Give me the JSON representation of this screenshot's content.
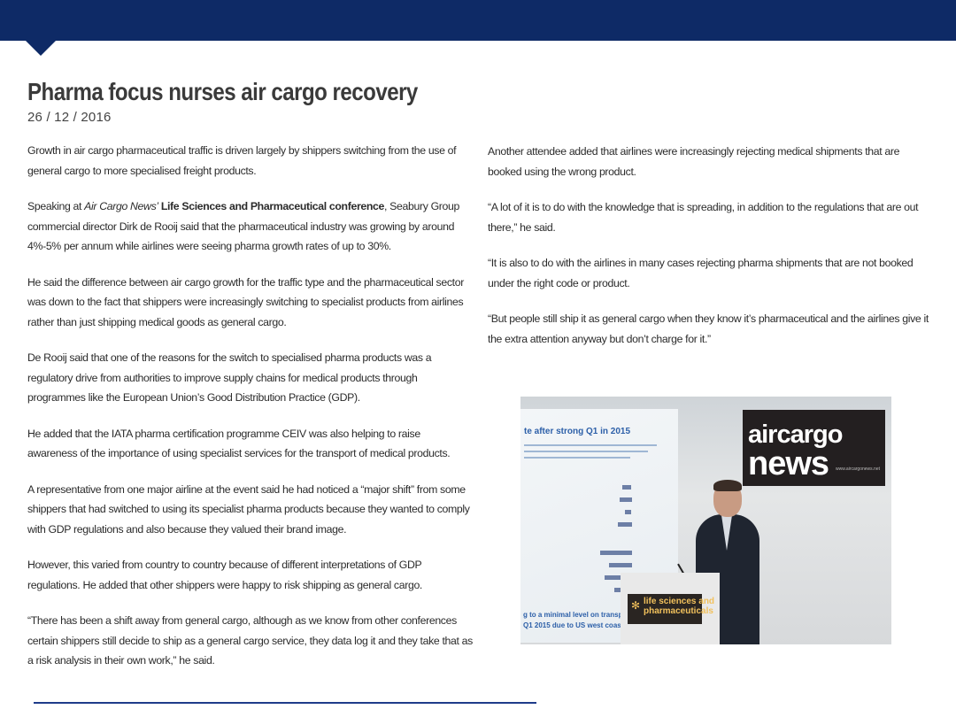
{
  "article": {
    "title": "Pharma focus nurses air cargo recovery",
    "date": "26 / 12 / 2016",
    "p1": "Growth in air cargo pharmaceutical traffic is driven largely by shippers switching from the use of general cargo to more specialised freight products.",
    "p2_pre": "Speaking at ",
    "p2_pub": "Air Cargo News’",
    "p2_conf": " Life Sciences and Pharmaceutical conference",
    "p2_post": ", Seabury Group commercial director Dirk de Rooij said that the pharmaceutical industry was growing by around 4%-5% per annum while airlines were seeing pharma growth rates of up to 30%.",
    "p3": "He said the difference between air cargo growth for the traffic type and the pharmaceutical sector was down to the fact that shippers were increasingly switching to specialist products from airlines rather than just shipping medical goods as general cargo.",
    "p4": "De Rooij said that one of the reasons for the switch to specialised pharma products was a regulatory drive from authorities to improve supply chains for medical products through programmes like the European Union’s Good Distribution Practice (GDP).",
    "p5": "He added that the IATA pharma certification programme CEIV was also helping to raise awareness of the importance of using specialist services for the transport of medical products.",
    "p6": "A representative from one major airline at the event said he had noticed a “major shift” from some shippers that had switched to using its specialist pharma products because they wanted to comply with GDP regulations and also because they valued their brand image.",
    "p7": "However, this varied from country to country because of different interpretations of GDP regulations. He added that other shippers were happy to risk shipping as general cargo.",
    "p8": "“There has been a shift away from general cargo, although as we know from other conferences certain shippers still decide to ship as a general cargo service, they data log it and they take that as a risk analysis in their own work,” he said.",
    "r1": "Another attendee added that airlines were increasingly rejecting medical shipments that are booked using the wrong product.",
    "r2": "“A lot of it is to do with the knowledge that is spreading, in addition to the regulations that are out there,” he said.",
    "r3": "“It is also to do with the airlines in many cases rejecting pharma shipments that are not booked under the right code or product.",
    "r4": "“But people still ship it as general cargo when they know it’s pharmaceutical and the airlines give it the extra attention anyway but don’t charge for it.”"
  },
  "photo": {
    "screen_title": "te after strong Q1 in 2015",
    "screen_caption_1": "g to a minimal level on transpacific flows",
    "screen_caption_2": "Q1 2015 due to US west coast port strike",
    "logo_line_1": "aircargo",
    "logo_line_2": "news",
    "logo_url": "www.aircargonews.net",
    "podium_line_1": "life sciences and",
    "podium_line_2": "pharmaceuticals"
  },
  "colors": {
    "header_navy": "#0e2a66",
    "rule_blue": "#1f3c8a"
  }
}
